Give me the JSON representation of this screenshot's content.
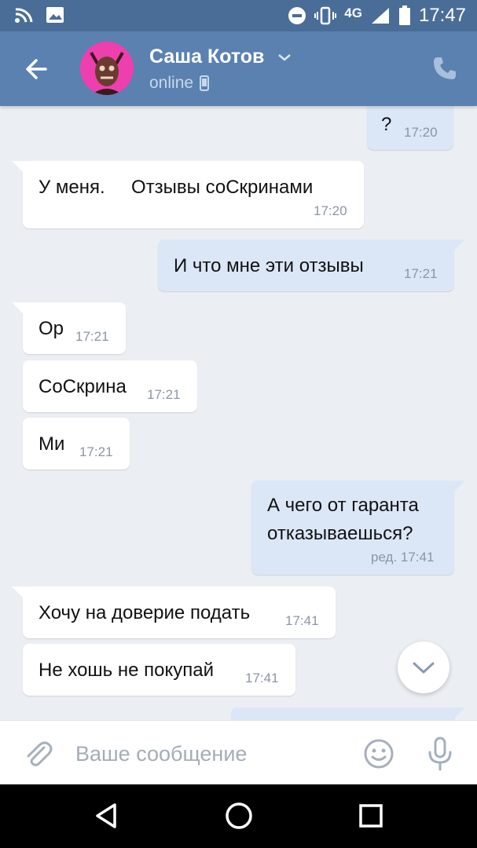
{
  "status_bar": {
    "time": "17:47",
    "network": "4G",
    "icons": [
      "wifi-icon",
      "image-icon",
      "do-not-disturb-icon",
      "vibrate-icon",
      "signal-icon",
      "battery-icon"
    ]
  },
  "header": {
    "contact_name": "Саша Котов",
    "status": "online",
    "icons": [
      "back-arrow-icon",
      "chevron-down-icon",
      "mobile-icon",
      "phone-icon"
    ]
  },
  "messages": [
    {
      "direction": "out",
      "text": "?",
      "time": "17:20"
    },
    {
      "direction": "in",
      "text": "У меня.     Отзывы соСкринами",
      "time": "17:20"
    },
    {
      "direction": "out",
      "text": "И что мне эти отзывы",
      "time": "17:21"
    },
    {
      "direction": "in",
      "text": "Ор",
      "time": "17:21"
    },
    {
      "direction": "in",
      "text": "СоСкрина",
      "time": "17:21"
    },
    {
      "direction": "in",
      "text": "Ми",
      "time": "17:21"
    },
    {
      "direction": "out",
      "text_lines": [
        "А чего от гаранта",
        "отказываешься?"
      ],
      "time": "ред. 17:41"
    },
    {
      "direction": "in",
      "text": "Хочу на доверие подать",
      "time": "17:41"
    },
    {
      "direction": "in",
      "text": "Не хошь не покупай",
      "time": "17:41"
    }
  ],
  "composer": {
    "placeholder": "Ваше сообщение",
    "icons": [
      "paperclip-icon",
      "emoji-icon",
      "microphone-icon"
    ]
  },
  "navbar": {
    "icons": [
      "back-triangle-icon",
      "home-circle-icon",
      "recents-square-icon"
    ]
  },
  "colors": {
    "header": "#5a81b0",
    "status_bar": "#4a6d98",
    "background": "#ebeef2",
    "incoming_bubble": "#ffffff",
    "outgoing_bubble": "#dbe7f7",
    "time_text": "#8a96a6"
  }
}
